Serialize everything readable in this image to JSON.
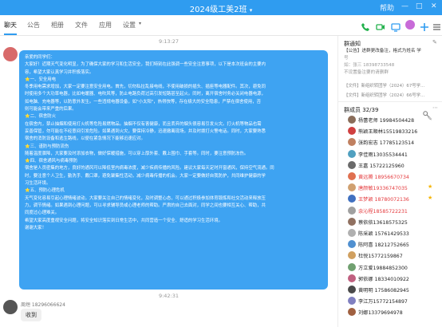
{
  "window": {
    "title": "2024级工美2班",
    "dropdown_icon": "chevron-down-icon",
    "win_labels": [
      "帮助",
      "—",
      "□",
      "✕"
    ]
  },
  "tabs": [
    {
      "label": "聊天",
      "active": true
    },
    {
      "label": "公告",
      "active": false
    },
    {
      "label": "相册",
      "active": false
    },
    {
      "label": "文件",
      "active": false
    },
    {
      "label": "应用",
      "active": false
    },
    {
      "label": "设置",
      "active": false
    }
  ],
  "toolbar_icons": [
    {
      "name": "call-icon",
      "color": "#22b14c"
    },
    {
      "name": "video-icon",
      "color": "#22b14c"
    },
    {
      "name": "screen-share-icon",
      "color": "#2f9cf0"
    },
    {
      "name": "more-apps-icon",
      "color": "#c86bd8"
    },
    {
      "name": "add-icon",
      "color": "#2f9cf0"
    },
    {
      "name": "menu-icon",
      "color": "#666666"
    }
  ],
  "chat": {
    "time1": "9:13:27",
    "message": {
      "lines": [
        {
          "text": "亲爱的同学们：",
          "head": true
        },
        {
          "text": "大家好！近期天气变化明显，为了确保大家的学习和生活安全，我们特别在此强调一些安全注意事项，以下是本次班会的主要内"
        },
        {
          "text": "容，希望大家认真学习并积极落实。"
        },
        {
          "text": "⭐一、安全用电",
          "head": true
        },
        {
          "text": "冬季用电需求增加，大家一定要注意安全用电。首先，切勿私拉乱接电线，不使用破损的插头、插座等电器配件。其次，避免同"
        },
        {
          "text": "时使用多个大功率电器，比如电暖器、电吹风等，防止电路负荷过高引发短路甚至起火。同时，离开宿舍时务必关闭电器电源，"
        },
        {
          "text": "如电脑、充电器等，以防意外发生。一些违规电器设备，如\"小太阳\"，热得快等，存在极大的安全隐患，严禁在宿舍使用，否"
        },
        {
          "text": "则可能会带来严重的后果。"
        },
        {
          "text": "⭐二、宿舍防火",
          "head": true
        },
        {
          "text": "在宿舍内，禁止抽烟和使用打火机等危险易燃物品。抽烟不仅有害健康，而且丢弃的烟头很容易引发火灾。打火机等物品也需"
        },
        {
          "text": "妥善保管，勿可能在不经意间引发危险。如果遇到火灾，要保持冷静，迅速撤离现场，并及时拨打火警电话。同时，大家要熟悉"
        },
        {
          "text": "宿舍的消防设备和逃生路线，以便在紧急情况下能够迅速应对。"
        },
        {
          "text": "⭐三、谨防与预防流伤",
          "head": true
        },
        {
          "text": "随着温度骤降，大家要及时添加衣物，做好保暖措施，可以穿上厚外套、戴上围巾、手套等。同时，要注意预防冻伤。"
        },
        {
          "text": "⭐四、宿舍通风与病毒预防",
          "head": true
        },
        {
          "text": "宿舍是人员密集的地方，良好的通风可以降低室内病毒浓度，减少疾病传播的风险。建议大家每天定时开窗通风，保持空气流通。同"
        },
        {
          "text": "时，要注意个人卫生，勤洗手、戴口罩，避免聚集性活动，减少病毒传播的机会。大家一定要做好自我防护，共同维护健康的学"
        },
        {
          "text": "习生活环境。"
        },
        {
          "text": "⭐五、预防心理危机",
          "head": true
        },
        {
          "text": "天气变化容易引起心理情绪波动，大家要关注自己的情绪变化，及时调整心态，可以通过积极参加体育锻炼和社交活动来释放压"
        },
        {
          "text": "力，调节情绪。如果遇到心理问题，可以寻求辅导员或心理老师的帮助。严肃的自己去面对，同学之间也要相互关心、帮助，共"
        },
        {
          "text": "同度过心理难关。"
        },
        {
          "text": "希望大家高度重视安全问题，将安全知识落实到日常生活中，共同营造一个安全、舒适的学习生活环境。"
        },
        {
          "text": "谢谢大家！"
        }
      ]
    },
    "time2": "9:42:31",
    "reply": {
      "sender": "周烜 18296066624",
      "text": "收到"
    }
  },
  "sidebar": {
    "notice_title": "群通知",
    "notice_lines": [
      "【公告】进群更改备注，格式为姓名 学",
      "号",
      "如：张三 18398733548",
      "不设置备注要的请删群"
    ],
    "files": [
      "【文件】新组织转团学（2024）67号学…",
      "【文件】新组织转团学（2024）66号学…"
    ],
    "members_title": "群成员 32/39",
    "members": [
      {
        "name": "杨蕾老师 19984504428",
        "color": "#222222",
        "icon": "✎",
        "avatar": "#8a6d5a"
      },
      {
        "name": "熊颖王顺林15519833216",
        "color": "#222222",
        "icon": "",
        "avatar": "#d04040"
      },
      {
        "name": "张韵宏志 17785123514",
        "color": "#222222",
        "icon": "",
        "avatar": "#c08060"
      },
      {
        "name": "李佳雨13035534441",
        "color": "#222222",
        "icon": "",
        "avatar": "#50a0c0"
      },
      {
        "name": "王嘉 15722125960",
        "color": "#222222",
        "icon": "",
        "avatar": "#6a6a6a"
      },
      {
        "name": "黄远腾 18956670734",
        "color": "#e4393c",
        "icon": "",
        "avatar": "#e07050"
      },
      {
        "name": "唐颜敏19336747035",
        "color": "#e4393c",
        "icon": "★",
        "avatar": "#d0a070"
      },
      {
        "name": "王梦颖  18780072136",
        "color": "#e4393c",
        "icon": "★",
        "avatar": "#4070c0"
      },
      {
        "name": "余沁程18585722231",
        "color": "#e4393c",
        "icon": "",
        "avatar": "#a0a0a0"
      },
      {
        "name": "蔡依依13618575325",
        "color": "#222222",
        "icon": "",
        "avatar": "#907060"
      },
      {
        "name": "陈采颖 15761429533",
        "color": "#222222",
        "icon": "",
        "avatar": "#b0b0b0"
      },
      {
        "name": "陈阿喜 18212752665",
        "color": "#222222",
        "icon": "",
        "avatar": "#5090d0"
      },
      {
        "name": "杜悦15772159867",
        "color": "#222222",
        "icon": "",
        "avatar": "#d0a060"
      },
      {
        "name": "方立爱19884852300",
        "color": "#222222",
        "icon": "",
        "avatar": "#70a070"
      },
      {
        "name": "郭依娜 18334010922",
        "color": "#222222",
        "icon": "",
        "avatar": "#c06080"
      },
      {
        "name": "黄明明 17586082945",
        "color": "#222222",
        "icon": "",
        "avatar": "#4a4a4a"
      },
      {
        "name": "李江万15772154897",
        "color": "#222222",
        "icon": "",
        "avatar": "#8080c0"
      },
      {
        "name": "刘娜13379694978",
        "color": "#222222",
        "icon": "",
        "avatar": "#a06040"
      }
    ]
  }
}
